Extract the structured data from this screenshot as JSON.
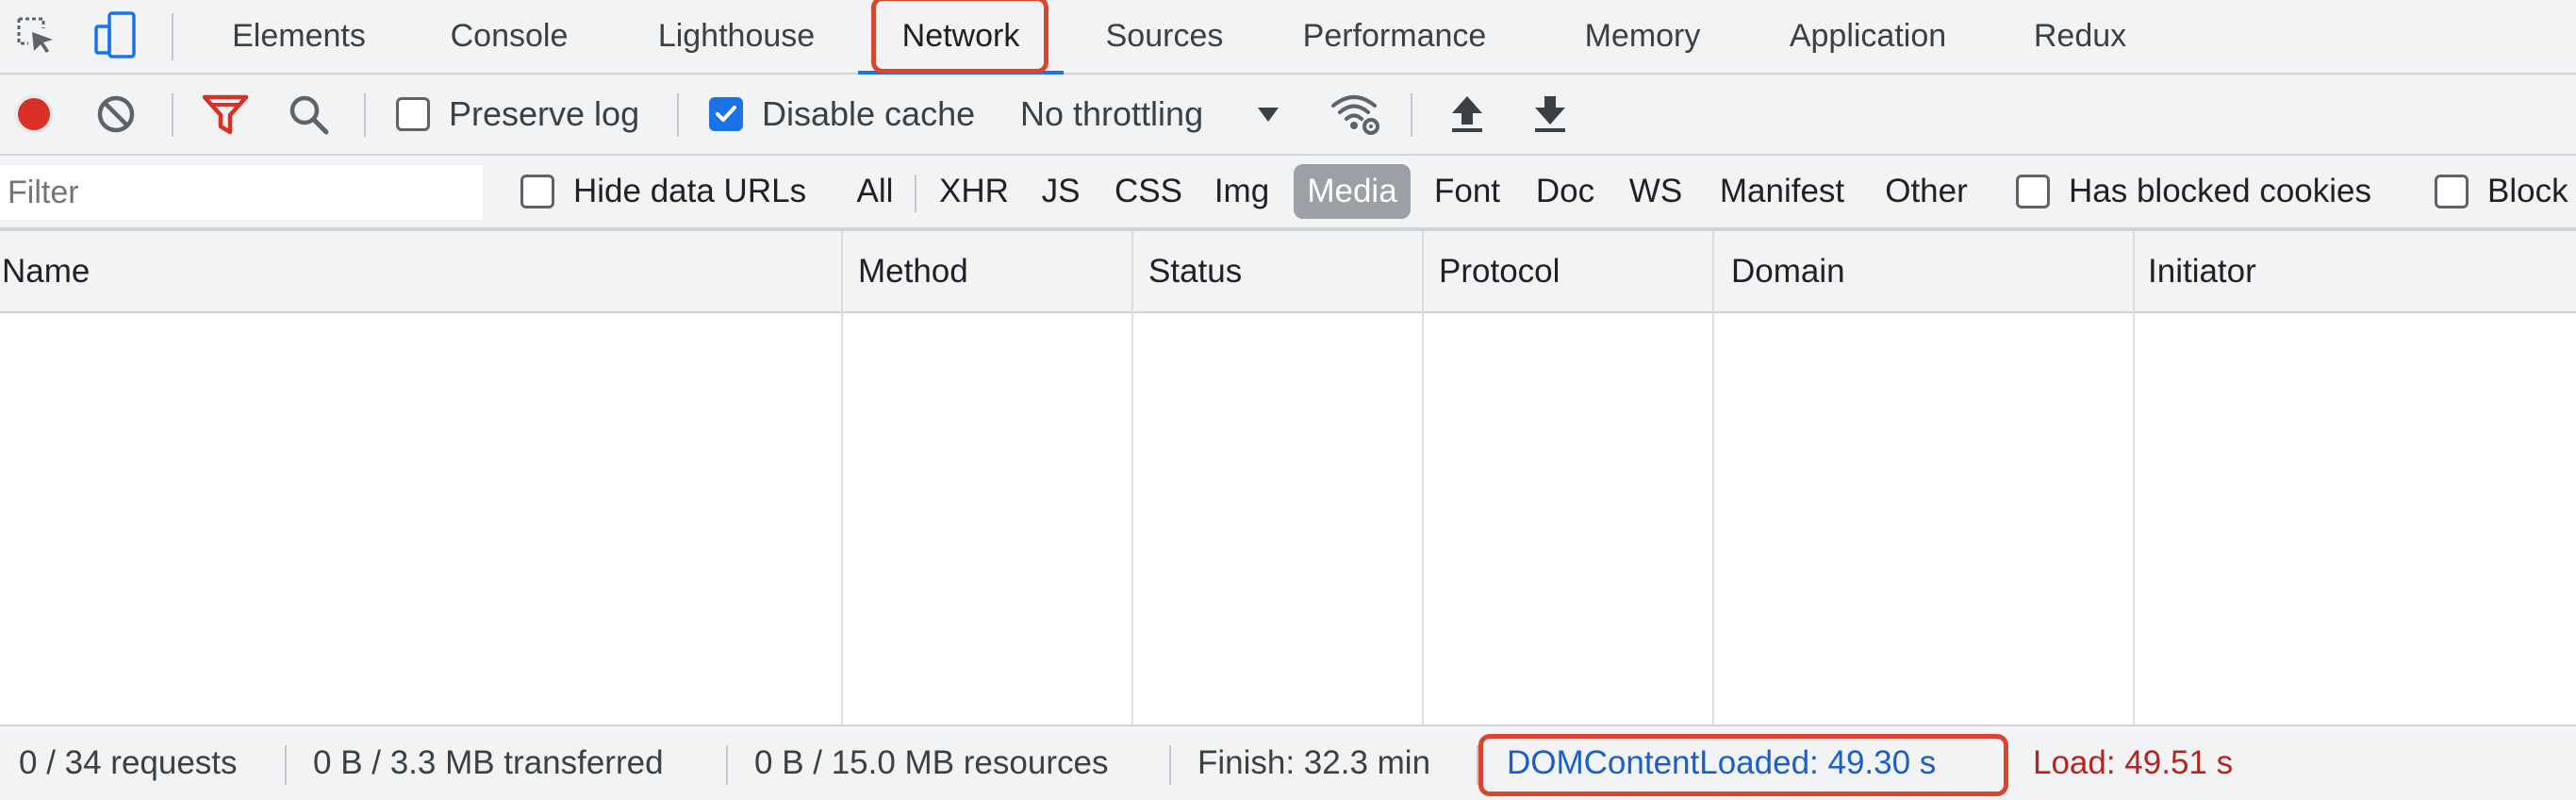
{
  "tabs": [
    {
      "label": "Elements",
      "active": false
    },
    {
      "label": "Console",
      "active": false
    },
    {
      "label": "Lighthouse",
      "active": false
    },
    {
      "label": "Network",
      "active": true
    },
    {
      "label": "Sources",
      "active": false
    },
    {
      "label": "Performance",
      "active": false
    },
    {
      "label": "Memory",
      "active": false
    },
    {
      "label": "Application",
      "active": false
    },
    {
      "label": "Redux",
      "active": false
    }
  ],
  "toolbar": {
    "preserve_log": {
      "label": "Preserve log",
      "checked": false
    },
    "disable_cache": {
      "label": "Disable cache",
      "checked": true
    },
    "throttling": {
      "selected": "No throttling"
    }
  },
  "filter": {
    "placeholder": "Filter",
    "value": "",
    "hide_data_urls": {
      "label": "Hide data URLs",
      "checked": false
    },
    "types": [
      {
        "label": "All",
        "selected": false
      },
      {
        "label": "XHR",
        "selected": false
      },
      {
        "label": "JS",
        "selected": false
      },
      {
        "label": "CSS",
        "selected": false
      },
      {
        "label": "Img",
        "selected": false
      },
      {
        "label": "Media",
        "selected": true
      },
      {
        "label": "Font",
        "selected": false
      },
      {
        "label": "Doc",
        "selected": false
      },
      {
        "label": "WS",
        "selected": false
      },
      {
        "label": "Manifest",
        "selected": false
      },
      {
        "label": "Other",
        "selected": false
      }
    ],
    "has_blocked_cookies": {
      "label": "Has blocked cookies",
      "checked": false
    },
    "blocked_requests": {
      "label": "Block",
      "checked": false
    }
  },
  "table": {
    "columns": [
      "Name",
      "Method",
      "Status",
      "Protocol",
      "Domain",
      "Initiator"
    ],
    "rows": []
  },
  "status": {
    "requests": "0 / 34 requests",
    "transferred": "0 B / 3.3 MB transferred",
    "resources": "0 B / 15.0 MB resources",
    "finish": "Finish: 32.3 min",
    "dom_content_loaded": "DOMContentLoaded: 49.30 s",
    "load": "Load: 49.51 s"
  },
  "colors": {
    "accent": "#1a73e8",
    "record": "#d93025",
    "highlight": "#d9452f",
    "dom_content_loaded": "#1a5fc8",
    "load": "#b3261e"
  }
}
